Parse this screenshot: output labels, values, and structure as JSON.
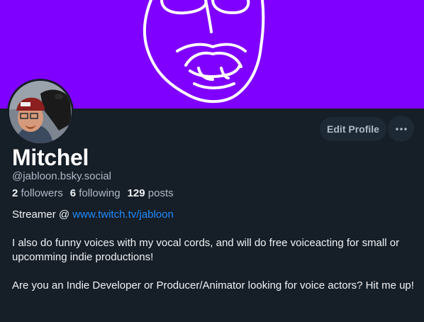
{
  "profile": {
    "display_name": "Mitchel",
    "handle": "@jabloon.bsky.social",
    "banner_color": "#8000ff"
  },
  "actions": {
    "edit_profile": "Edit Profile",
    "more_icon": "ellipsis-icon"
  },
  "stats": {
    "followers_count": "2",
    "followers_label": "followers",
    "following_count": "6",
    "following_label": "following",
    "posts_count": "129",
    "posts_label": "posts"
  },
  "bio": {
    "streamer_prefix": "Streamer @ ",
    "twitch_link": "www.twitch.tv/jabloon",
    "line2": "I also do funny voices with my vocal cords, and will do free voiceacting for small or upcomming indie productions!",
    "line3": "Are you an Indie Developer or Producer/Animator looking for voice actors? Hit me up!"
  },
  "colors": {
    "background": "#161e27",
    "link": "#208bfe",
    "button_bg": "#1e2936"
  }
}
